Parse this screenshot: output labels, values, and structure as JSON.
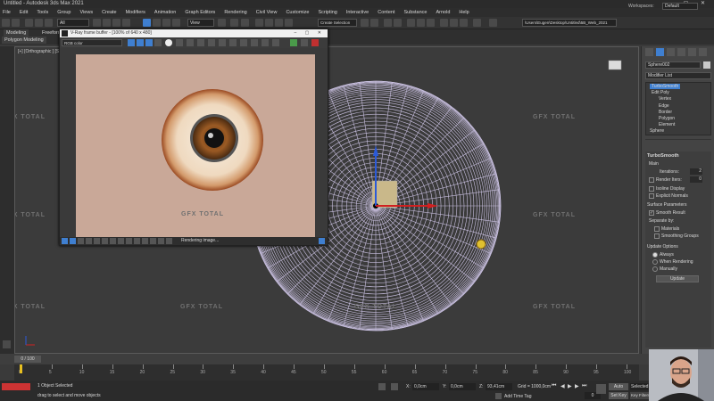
{
  "app": {
    "title": "Untitled - Autodesk 3ds Max 2021"
  },
  "menu": [
    "File",
    "Edit",
    "Tools",
    "Group",
    "Views",
    "Create",
    "Modifiers",
    "Animation",
    "Graph Editors",
    "Rendering",
    "Civil View",
    "Customize",
    "Scripting",
    "Interactive",
    "Content",
    "Substance",
    "Arnold",
    "Help"
  ],
  "workspace": {
    "label": "Workspaces:",
    "value": "Default"
  },
  "toolbar": {
    "filter_value": "All",
    "view_value": "View",
    "selection_set": "Create Selection Se",
    "path": "\\Users\\Eugen\\Desktop\\Untitled\\5B_Web_2021"
  },
  "ribbon": {
    "tabs": [
      "Modeling",
      "Freeform"
    ],
    "subtab": "Polygon Modeling"
  },
  "viewport": {
    "label": "[+] [Orthographic ] [S"
  },
  "watermark": "GFX TOTAL",
  "vfb": {
    "title": "V-Ray frame buffer - [100% of 640 x 480]",
    "channel": "RGB color",
    "status": "Rendering image...",
    "colors": {
      "background": "#c9a898",
      "iris": "#9a5a24",
      "pupil": "#111111"
    }
  },
  "command_panel": {
    "object_name": "Sphere002",
    "modifier_list": "Modifier List",
    "stack": [
      "TurboSmooth",
      "Edit Poly",
      "Vertex",
      "Edge",
      "Border",
      "Polygon",
      "Element",
      "Sphere"
    ],
    "rollout_title": "TurboSmooth",
    "main_label": "Main",
    "iterations_label": "Iterations:",
    "iterations": "2",
    "render_iters_label": "Render Iters:",
    "render_iters": "0",
    "isoline": "Isoline Display",
    "explicit": "Explicit Normals",
    "surface_params": "Surface Parameters",
    "smooth_result": "Smooth Result",
    "separate_by": "Separate by:",
    "materials": "Materials",
    "smoothing_groups": "Smoothing Groups",
    "update_options": "Update Options",
    "always": "Always",
    "when_rendering": "When Rendering",
    "manually": "Manually",
    "update_button": "Update"
  },
  "timeline": {
    "frame": "0 / 100",
    "ticks": [
      "0",
      "5",
      "10",
      "15",
      "20",
      "25",
      "30",
      "35",
      "40",
      "45",
      "50",
      "55",
      "60",
      "65",
      "70",
      "75",
      "80",
      "85",
      "90",
      "95",
      "100"
    ]
  },
  "status": {
    "selected": "1 Object Selected",
    "prompt": "drag to select and move objects",
    "x_label": "X:",
    "x": "0,0cm",
    "y_label": "Y:",
    "y": "0,0cm",
    "z_label": "Z:",
    "z": "93,41cm",
    "grid": "Grid = 1000,0cm",
    "add_time_tag": "Add Time Tag",
    "auto": "Auto",
    "set_key": "Set Key",
    "selected_btn": "Selected",
    "key_filters": "Key Filters...",
    "frame_input": "0"
  }
}
